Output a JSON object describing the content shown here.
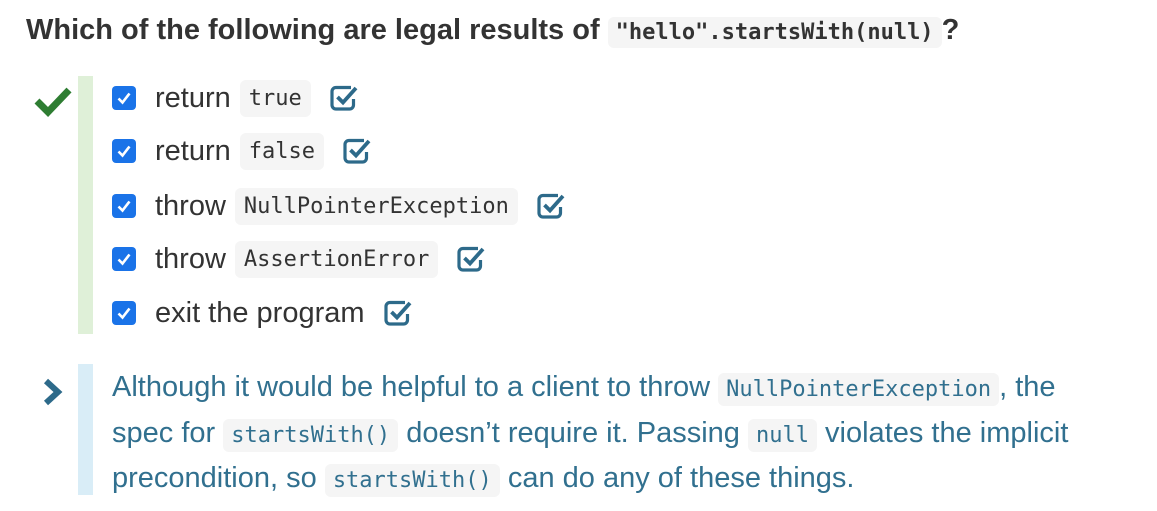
{
  "question": {
    "text_before": "Which of the following are legal results of",
    "code": "\"hello\".startsWith(null)",
    "text_after": "?"
  },
  "options": [
    {
      "text": "return",
      "code": "true",
      "checked": true
    },
    {
      "text": "return",
      "code": "false",
      "checked": true
    },
    {
      "text": "throw",
      "code": "NullPointerException",
      "checked": true
    },
    {
      "text": "throw",
      "code": "AssertionError",
      "checked": true
    },
    {
      "text": "exit the program",
      "code": "",
      "checked": true
    }
  ],
  "explanation": {
    "p1": "Although it would be helpful to a client to throw",
    "c1": "NullPointerException",
    "p2": ", the spec for",
    "c2": "startsWith()",
    "p3": "doesn’t require it. Passing",
    "c3": "null",
    "p4": "violates the implicit precondition, so",
    "c4": "startsWith()",
    "p5": "can do any of these things."
  },
  "colors": {
    "correct": "#2e7d32",
    "checkbox": "#1a73e8",
    "review_icon": "#2d6a8a",
    "explanation": "#31708f"
  },
  "icons": {
    "correct": "checkmark-icon",
    "checkbox": "checkbox-checked-icon",
    "review": "square-check-icon",
    "expand": "chevron-right-icon"
  }
}
